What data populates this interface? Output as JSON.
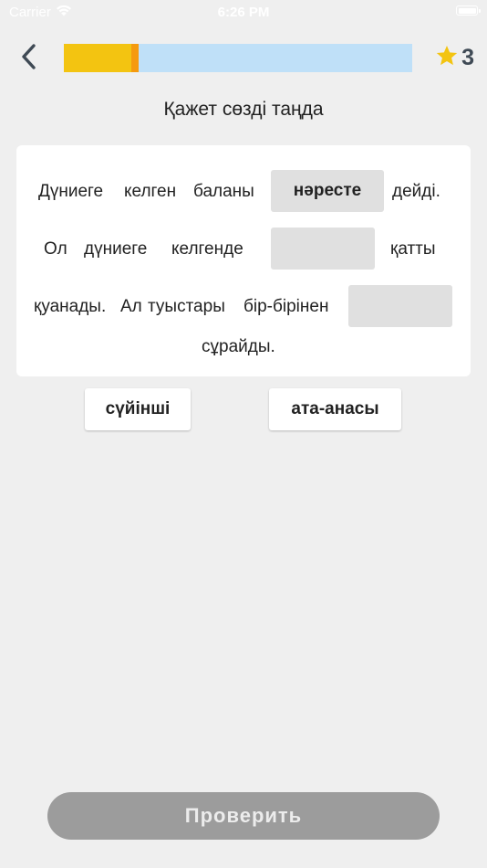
{
  "status_bar": {
    "carrier": "Carrier",
    "time": "6:26 PM"
  },
  "header": {
    "progress": 0.215,
    "score": "3",
    "colors": {
      "track": "#bfe0f8",
      "fill": "#f3c411",
      "fill_cap": "#f59a0e",
      "star": "#f3c411"
    }
  },
  "task": {
    "title": "Қажет сөзді таңда",
    "line1": {
      "w1": "Дүниеге",
      "w2": "келген",
      "w3": "баланы",
      "slot": "нәресте",
      "w4": "дейді."
    },
    "line2": {
      "w1": "Ол",
      "w2": "дүниеге",
      "w3": "келгенде",
      "slot": "",
      "w4": "қатты"
    },
    "line3": {
      "w1": "қуанады.",
      "w2": "Ал",
      "w3": "туыстары",
      "w4": "бір-бірінен",
      "slot": ""
    },
    "line4": {
      "w1": "сұрайды."
    }
  },
  "options": [
    {
      "label": "сүйінші"
    },
    {
      "label": "ата-анасы"
    }
  ],
  "footer": {
    "check_label": "Проверить"
  }
}
